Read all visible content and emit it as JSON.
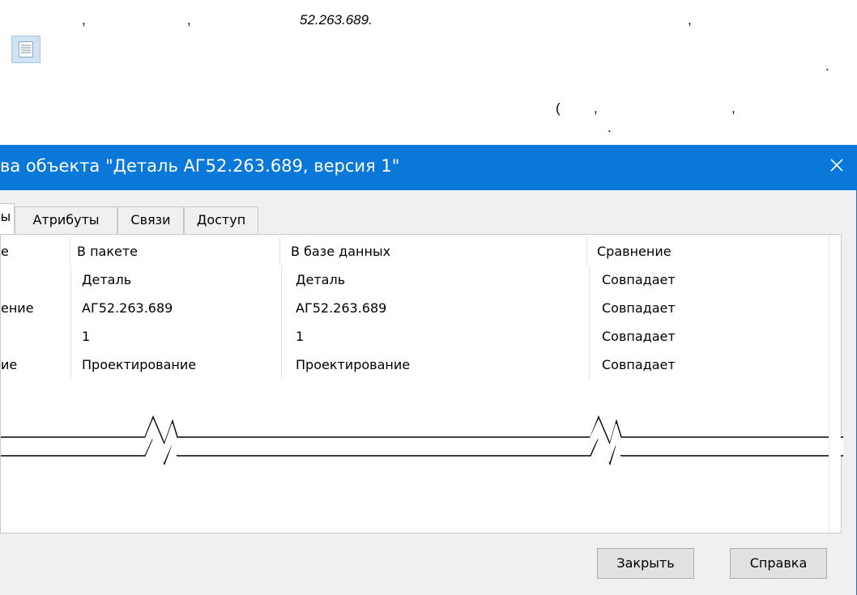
{
  "doc": {
    "line1": [
      ",",
      ",",
      "52.263.689.",
      ","
    ],
    "line2_period": ".",
    "line3": [
      "(",
      ",",
      ","
    ],
    "line4_period": "."
  },
  "dialog": {
    "title": "ва объекта \"Деталь АГ52.263.689, версия 1\"",
    "tabs": [
      {
        "label": "ы"
      },
      {
        "label": "Атрибуты"
      },
      {
        "label": "Связи"
      },
      {
        "label": "Доступ"
      }
    ],
    "columns": [
      "е",
      "В пакете",
      "В базе данных",
      "Сравнение"
    ],
    "rows": [
      {
        "name": "",
        "package": "Деталь",
        "database": "Деталь",
        "compare": "Совпадает"
      },
      {
        "name": "ение",
        "package": "АГ52.263.689",
        "database": "АГ52.263.689",
        "compare": "Совпадает"
      },
      {
        "name": "",
        "package": "1",
        "database": "1",
        "compare": "Совпадает"
      },
      {
        "name": "ие",
        "package": "Проектирование",
        "database": "Проектирование",
        "compare": "Совпадает"
      }
    ],
    "buttons": {
      "close_label": "Закрыть",
      "help_label": "Справка"
    }
  }
}
